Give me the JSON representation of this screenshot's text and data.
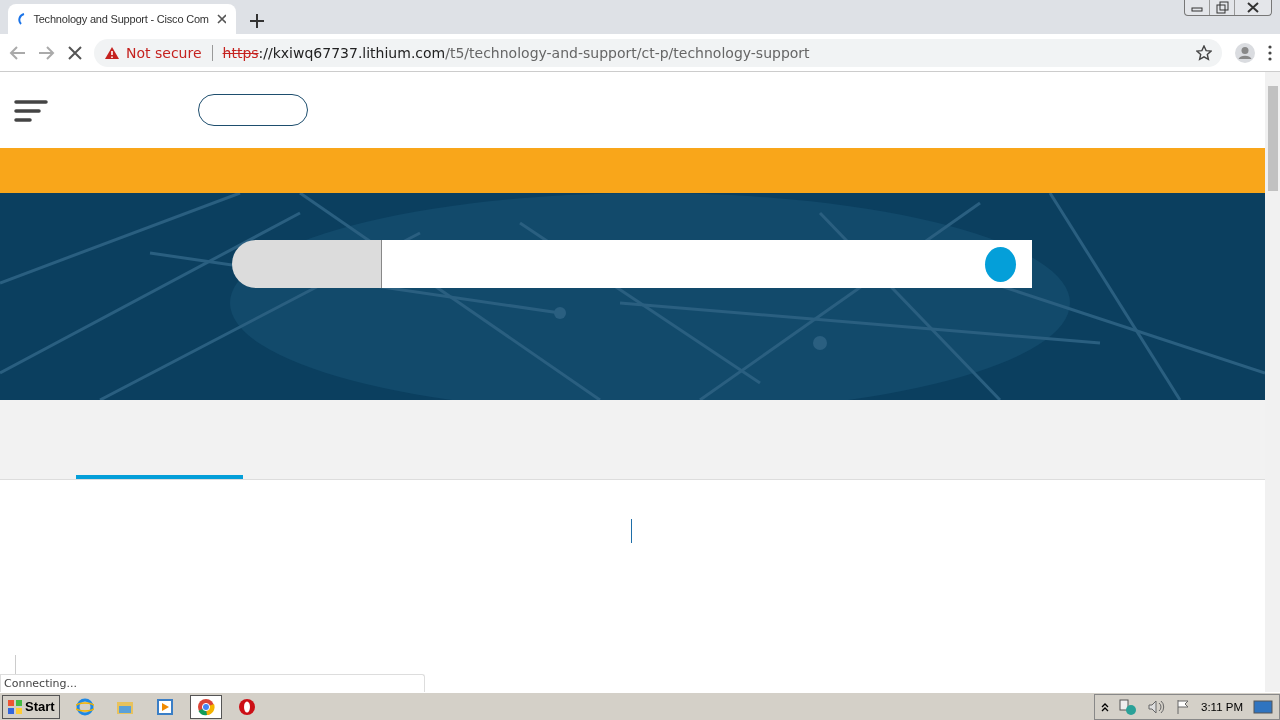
{
  "browser": {
    "tab": {
      "title": "Technology and Support - Cisco Com"
    },
    "address": {
      "security": "Not secure",
      "scheme": "https",
      "host": "://kxiwq67737.lithium.com",
      "path": "/t5/technology-and-support/ct-p/technology-support"
    }
  },
  "page": {
    "content_tabs": [
      {
        "selected": true
      }
    ]
  },
  "status_bar": "Connecting...",
  "taskbar": {
    "start": "Start",
    "apps": [
      {
        "kind": "ie",
        "selected": false
      },
      {
        "kind": "folder",
        "selected": false
      },
      {
        "kind": "media",
        "selected": false
      },
      {
        "kind": "chrome",
        "selected": true
      },
      {
        "kind": "opera",
        "selected": false
      }
    ],
    "clock": "3:11 PM"
  }
}
